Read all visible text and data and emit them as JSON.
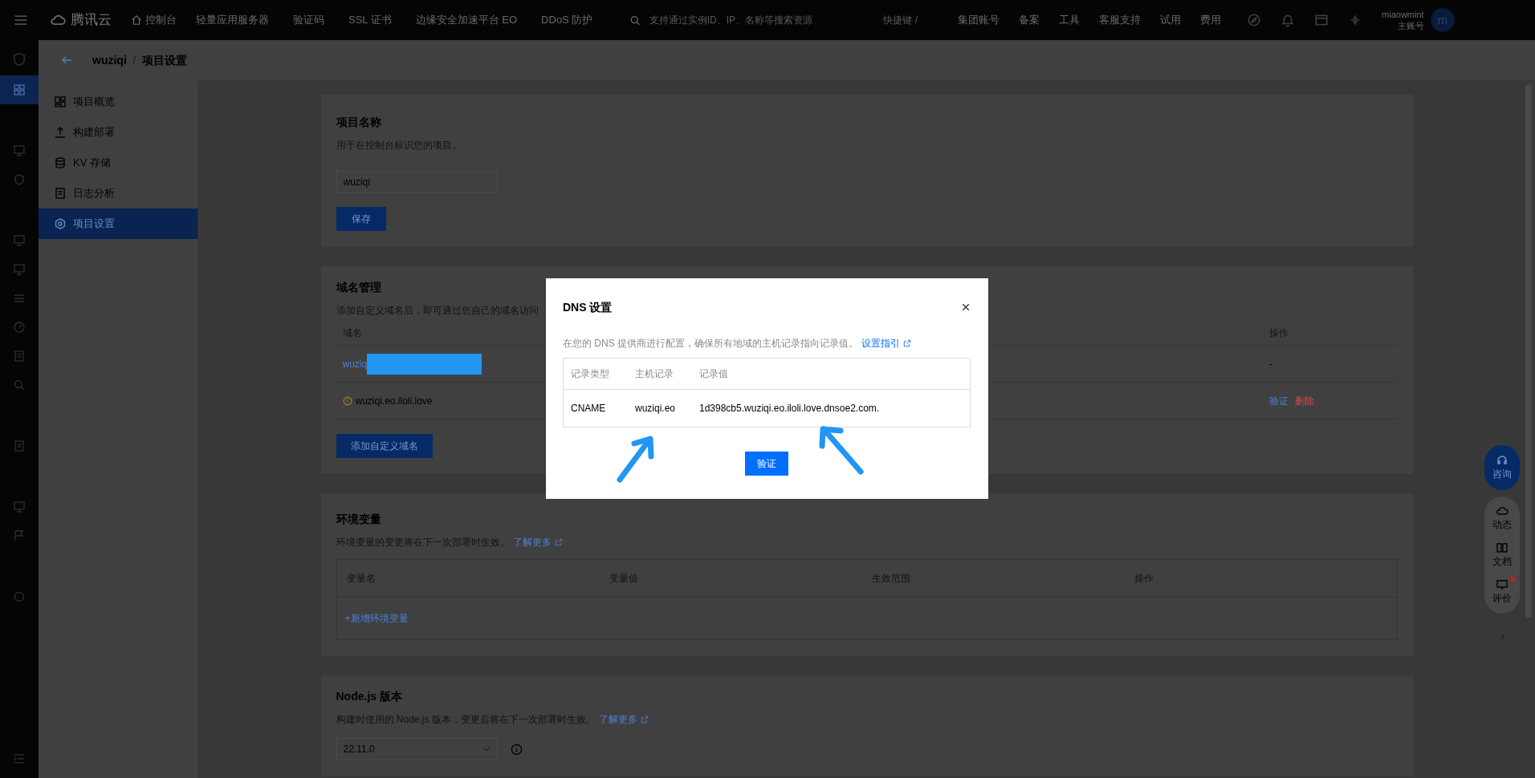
{
  "top_nav": {
    "logo": "腾讯云",
    "home": "控制台",
    "products": [
      "轻量应用服务器",
      "验证码",
      "SSL 证书",
      "边缘安全加速平台 EO",
      "DDoS 防护"
    ],
    "search": {
      "placeholder": "支持通过实例ID、IP、名称等搜索资源"
    },
    "shortcut": "快捷键 /",
    "links": [
      "集团账号",
      "备案",
      "工具",
      "客服支持",
      "试用",
      "费用"
    ],
    "user": {
      "name": "miaowmint",
      "role": "主账号",
      "avatar": "m"
    }
  },
  "rail": {
    "groups": [
      [
        {
          "kind": "grid",
          "selected": true
        }
      ],
      [
        {
          "kind": "monitor",
          "selected": false
        },
        {
          "kind": "shield",
          "selected": false
        }
      ],
      [
        {
          "kind": "monitor",
          "selected": false
        },
        {
          "kind": "monitor",
          "selected": false
        },
        {
          "kind": "list",
          "selected": false
        },
        {
          "kind": "gauge",
          "selected": false
        },
        {
          "kind": "document",
          "selected": false
        },
        {
          "kind": "search",
          "selected": false
        }
      ],
      [
        {
          "kind": "document",
          "selected": false
        }
      ],
      [
        {
          "kind": "monitor",
          "selected": false
        },
        {
          "kind": "flag",
          "selected": false
        }
      ],
      [
        {
          "kind": "circle",
          "selected": false
        }
      ]
    ]
  },
  "breadcrumb": {
    "project": "wuziqi",
    "separator": "/",
    "page": "项目设置"
  },
  "sidebar": {
    "items": [
      {
        "label": "项目概览",
        "kind": "overview",
        "selected": false
      },
      {
        "label": "构建部署",
        "kind": "upload",
        "selected": false
      },
      {
        "label": "KV 存储",
        "kind": "database",
        "selected": false
      },
      {
        "label": "日志分析",
        "kind": "document",
        "selected": false
      },
      {
        "label": "项目设置",
        "kind": "settings",
        "selected": true
      }
    ]
  },
  "project_name": {
    "title": "项目名称",
    "description": "用于在控制台标识您的项目。",
    "value": "wuziqi",
    "save": "保存"
  },
  "domains": {
    "title": "域名管理",
    "description": "添加自定义域名后，即可通过您自己的域名访问",
    "columns": [
      "域名",
      "操作"
    ],
    "rows": [
      {
        "domain": "wuziq",
        "link": true,
        "redacted": true,
        "warning": false,
        "actions": [
          {
            "label": "-",
            "kind": "text"
          }
        ]
      },
      {
        "domain": "wuziqi.eo.iloli.love",
        "link": false,
        "redacted": false,
        "warning": true,
        "actions": [
          {
            "label": "验证",
            "kind": "link"
          },
          {
            "label": "删除",
            "kind": "danger"
          }
        ]
      }
    ],
    "add_button": "添加自定义域名"
  },
  "env": {
    "title": "环境变量",
    "description": "环境变量的变更将在下一次部署时生效。",
    "link": "了解更多",
    "columns": [
      "变量名",
      "变量值",
      "生效范围",
      "操作"
    ],
    "add_link": "+新增环境变量"
  },
  "nodejs": {
    "title": "Node.js 版本",
    "description": "构建时使用的 Node.js 版本，变更后将在下一次部署时生效。",
    "link": "了解更多",
    "version": "22.11.0"
  },
  "modal": {
    "title": "DNS 设置",
    "description": "在您的 DNS 提供商进行配置，确保所有地域的主机记录指向记录值。",
    "guide_link": "设置指引",
    "columns": [
      "记录类型",
      "主机记录",
      "记录值"
    ],
    "rows": [
      [
        "CNAME",
        "wuziqi.eo",
        "1d398cb5.wuziqi.eo.iloli.love.dnsoe2.com."
      ]
    ],
    "verify_button": "验证"
  },
  "float_panel": {
    "consult": "咨询",
    "items": [
      {
        "label": "动态",
        "kind": "cloud",
        "badge": false
      },
      {
        "label": "文档",
        "kind": "book",
        "badge": false
      },
      {
        "label": "评价",
        "kind": "comment",
        "badge": true
      }
    ]
  }
}
